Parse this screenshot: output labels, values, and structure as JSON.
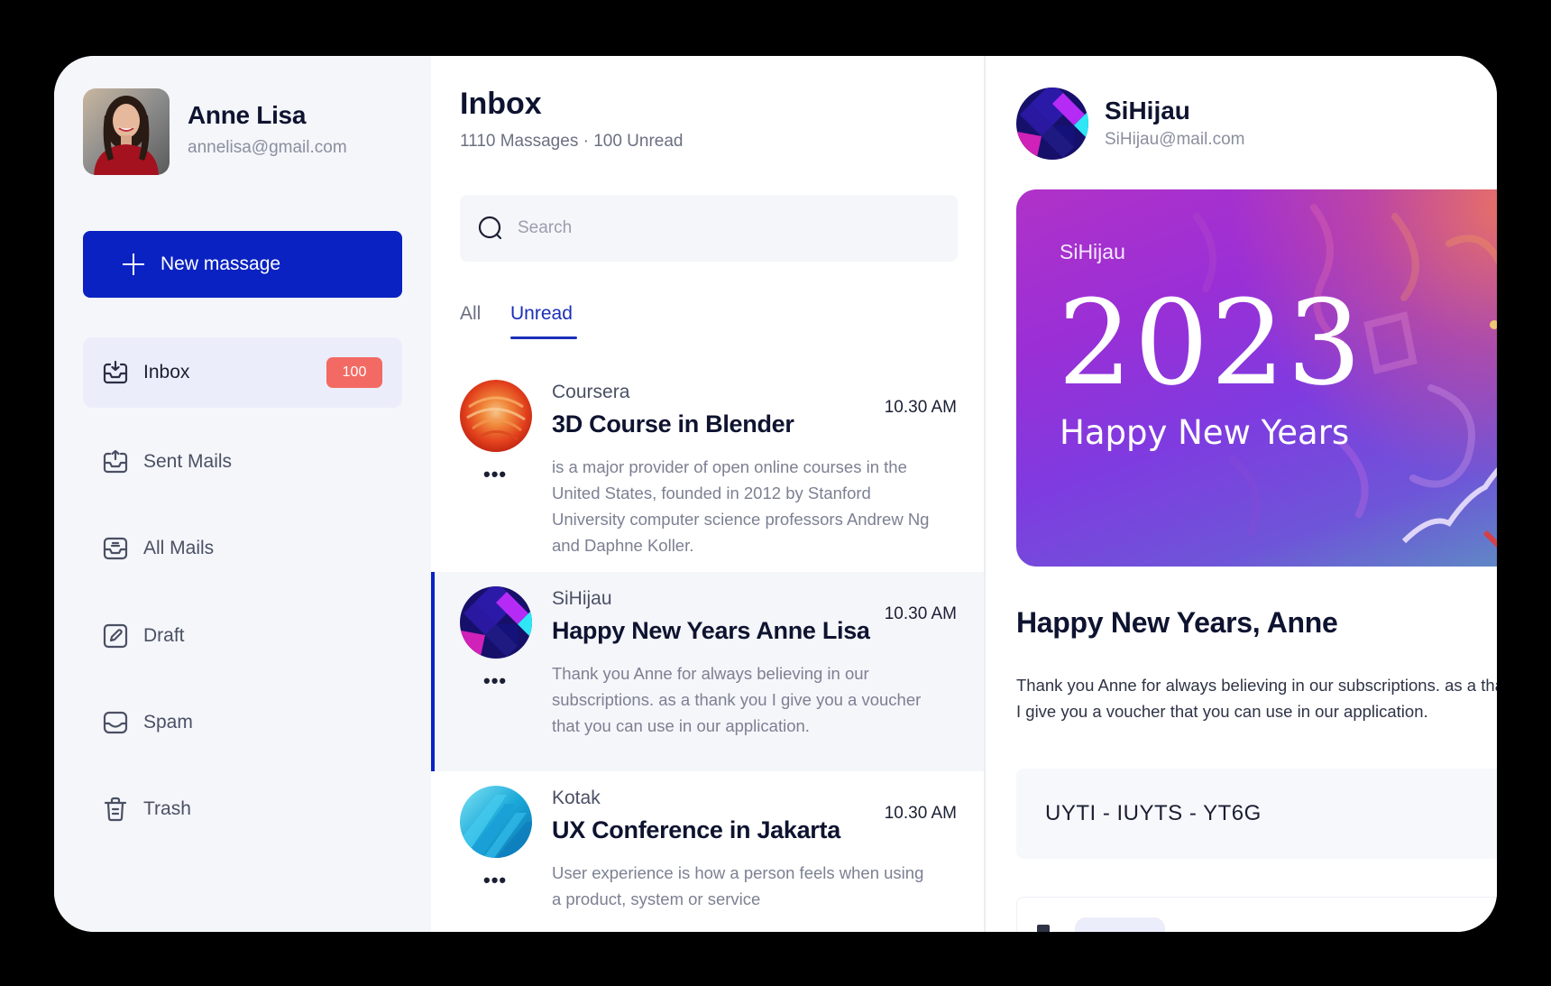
{
  "user": {
    "name": "Anne Lisa",
    "email": "annelisa@gmail.com"
  },
  "sidebar": {
    "new_button_label": "New massage",
    "items": [
      {
        "label": "Inbox",
        "icon": "inbox-download-icon",
        "active": true,
        "badge": "100"
      },
      {
        "label": "Sent Mails",
        "icon": "inbox-upload-icon"
      },
      {
        "label": "All Mails",
        "icon": "all-mails-icon"
      },
      {
        "label": "Draft",
        "icon": "draft-pencil-icon"
      },
      {
        "label": "Spam",
        "icon": "spam-tray-icon"
      },
      {
        "label": "Trash",
        "icon": "trash-icon"
      }
    ]
  },
  "inbox": {
    "title": "Inbox",
    "subtitle": "1110 Massages · 100 Unread",
    "search_placeholder": "Search",
    "tabs": [
      {
        "label": "All",
        "active": false
      },
      {
        "label": "Unread",
        "active": true
      }
    ],
    "mails": [
      {
        "sender": "Coursera",
        "subject": "3D Course in Blender",
        "time": "10.30 AM",
        "preview": "is a major provider of open online courses in the United States, founded in 2012 by Stanford University computer science professors Andrew Ng and Daphne Koller.",
        "selected": false
      },
      {
        "sender": "SiHijau",
        "subject": "Happy New Years Anne Lisa",
        "time": "10.30 AM",
        "preview": "Thank you Anne for always believing in our subscriptions. as a thank you I give you a voucher that you can use in our application.",
        "selected": true
      },
      {
        "sender": "Kotak",
        "subject": "UX Conference in Jakarta",
        "time": "10.30 AM",
        "preview": "User experience is how a person feels when using a product, system or service",
        "selected": false
      }
    ],
    "more_label": "•••"
  },
  "message": {
    "sender_name": "SiHijau",
    "sender_email": "SiHijau@mail.com",
    "banner": {
      "brand": "SiHijau",
      "year": "2023",
      "greeting": "Happy New Years"
    },
    "title": "Happy New Years, Anne",
    "body_line1": "Thank you Anne for always believing in our subscriptions. as a thank you",
    "body_line2": "I give you a voucher that you can use in our application.",
    "voucher_code": "UYTI - IUYTS - YT6G"
  },
  "colors": {
    "primary": "#0A22C2",
    "badge": "#F26A63",
    "tab_active": "#1B2FB8",
    "sidebar_bg": "#F5F6FA"
  }
}
